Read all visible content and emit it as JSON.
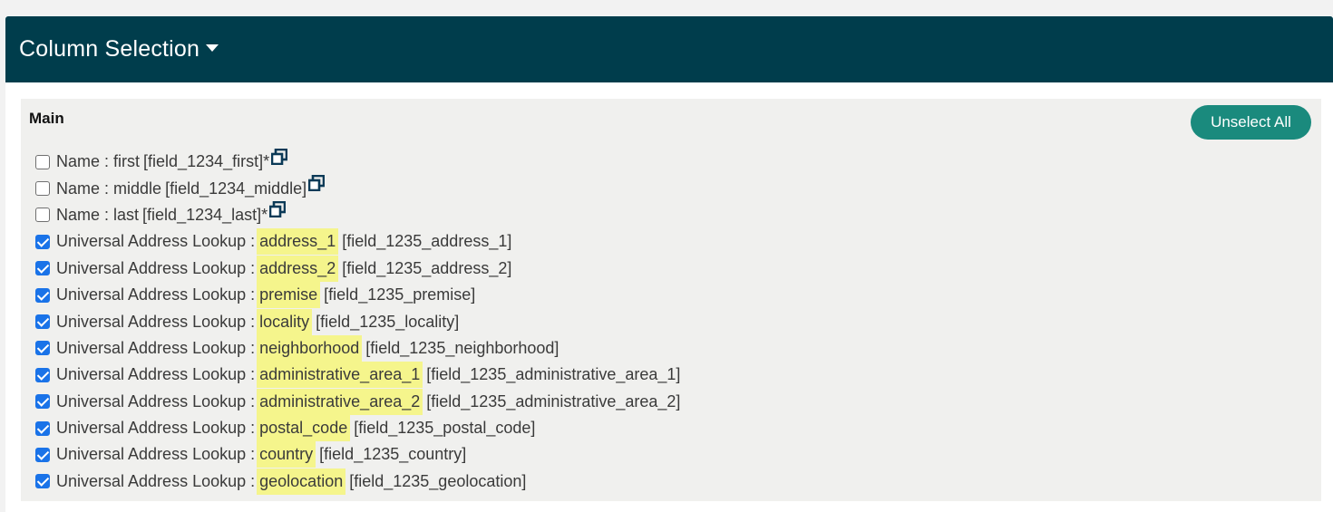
{
  "header": {
    "title": "Column Selection"
  },
  "section": {
    "title": "Main",
    "unselect_label": "Unselect All"
  },
  "rows": [
    {
      "checked": false,
      "group": "Name",
      "field": "first",
      "key": "[field_1234_first]",
      "suffix": "*",
      "copy": true,
      "highlight": false
    },
    {
      "checked": false,
      "group": "Name",
      "field": "middle",
      "key": "[field_1234_middle]",
      "suffix": "",
      "copy": true,
      "highlight": false
    },
    {
      "checked": false,
      "group": "Name",
      "field": "last",
      "key": "[field_1234_last]",
      "suffix": "*",
      "copy": true,
      "highlight": false
    },
    {
      "checked": true,
      "group": "Universal Address Lookup",
      "field": "address_1",
      "key": "[field_1235_address_1]",
      "suffix": "",
      "copy": false,
      "highlight": true
    },
    {
      "checked": true,
      "group": "Universal Address Lookup",
      "field": "address_2",
      "key": "[field_1235_address_2]",
      "suffix": "",
      "copy": false,
      "highlight": true
    },
    {
      "checked": true,
      "group": "Universal Address Lookup",
      "field": "premise",
      "key": "[field_1235_premise]",
      "suffix": "",
      "copy": false,
      "highlight": true
    },
    {
      "checked": true,
      "group": "Universal Address Lookup",
      "field": "locality",
      "key": "[field_1235_locality]",
      "suffix": "",
      "copy": false,
      "highlight": true
    },
    {
      "checked": true,
      "group": "Universal Address Lookup",
      "field": "neighborhood",
      "key": "[field_1235_neighborhood]",
      "suffix": "",
      "copy": false,
      "highlight": true
    },
    {
      "checked": true,
      "group": "Universal Address Lookup",
      "field": "administrative_area_1",
      "key": "[field_1235_administrative_area_1]",
      "suffix": "",
      "copy": false,
      "highlight": true
    },
    {
      "checked": true,
      "group": "Universal Address Lookup",
      "field": "administrative_area_2",
      "key": "[field_1235_administrative_area_2]",
      "suffix": "",
      "copy": false,
      "highlight": true
    },
    {
      "checked": true,
      "group": "Universal Address Lookup",
      "field": "postal_code",
      "key": "[field_1235_postal_code]",
      "suffix": "",
      "copy": false,
      "highlight": true
    },
    {
      "checked": true,
      "group": "Universal Address Lookup",
      "field": "country",
      "key": "[field_1235_country]",
      "suffix": "",
      "copy": false,
      "highlight": true
    },
    {
      "checked": true,
      "group": "Universal Address Lookup",
      "field": "geolocation",
      "key": "[field_1235_geolocation]",
      "suffix": "",
      "copy": false,
      "highlight": true
    }
  ],
  "colors": {
    "header_bg": "#003d4c",
    "button_bg": "#1a8a7d",
    "highlight": "#f5f58c",
    "checkbox_on": "#1a73e8"
  },
  "icons": {
    "copy": "copy-icon",
    "caret": "caret-down-icon"
  }
}
